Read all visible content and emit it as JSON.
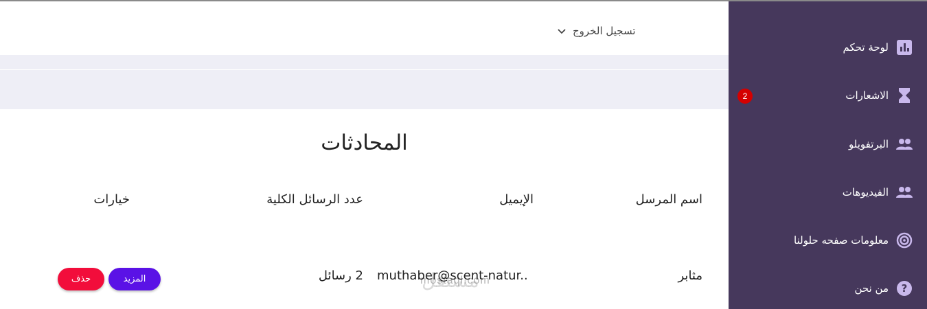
{
  "header": {
    "logout_label": "تسجيل الخروج"
  },
  "sidebar": {
    "items": [
      {
        "label": "لوحة تحكم",
        "icon": "chart-icon"
      },
      {
        "label": "الاشعارات",
        "icon": "hourglass-icon",
        "badge": "2"
      },
      {
        "label": "البرتفويلو",
        "icon": "people-icon"
      },
      {
        "label": "الفيديوهات",
        "icon": "people-icon"
      },
      {
        "label": "معلومات صفحه حلولنا",
        "icon": "target-icon"
      },
      {
        "label": "من نحن",
        "icon": "help-icon"
      }
    ],
    "colors": {
      "background": "#46385c",
      "icon": "#c9b8ec",
      "badge": "#d40000"
    }
  },
  "main": {
    "title": "المحادثات",
    "table": {
      "headers": [
        "اسم المرسل",
        "الإيميل",
        "عدد الرسائل الكلية",
        "خيارات"
      ],
      "rows": [
        {
          "sender": "مثابر",
          "email": "muthaber@scent-natur..",
          "count": "2 رسائل",
          "more_label": "المزيد",
          "delete_label": "حذف"
        }
      ]
    }
  },
  "watermark": {
    "text": "mostaql.com",
    "arabic": "مستقل"
  }
}
